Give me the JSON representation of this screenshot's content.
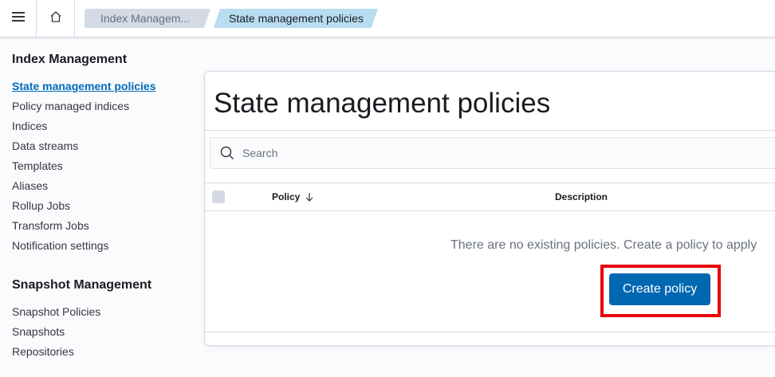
{
  "header": {
    "menu_icon": "hamburger-menu-icon",
    "home_icon": "home-icon",
    "breadcrumbs": [
      "Index Managem...",
      "State management policies"
    ]
  },
  "sidebar": {
    "index_section_title": "Index Management",
    "index_items": [
      "State management policies",
      "Policy managed indices",
      "Indices",
      "Data streams",
      "Templates",
      "Aliases",
      "Rollup Jobs",
      "Transform Jobs",
      "Notification settings"
    ],
    "snapshot_section_title": "Snapshot Management",
    "snapshot_items": [
      "Snapshot Policies",
      "Snapshots",
      "Repositories"
    ]
  },
  "main": {
    "title": "State management policies",
    "search": {
      "placeholder": "Search",
      "icon": "search-icon"
    },
    "table": {
      "columns": [
        "Policy",
        "Description"
      ],
      "sort_icon": "arrow-down-icon"
    },
    "empty_message": "There are no existing policies. Create a policy to apply",
    "create_button_label": "Create policy"
  },
  "colors": {
    "accent": "#006bb8",
    "button": "#0067b1",
    "highlight": "#e8000c"
  }
}
